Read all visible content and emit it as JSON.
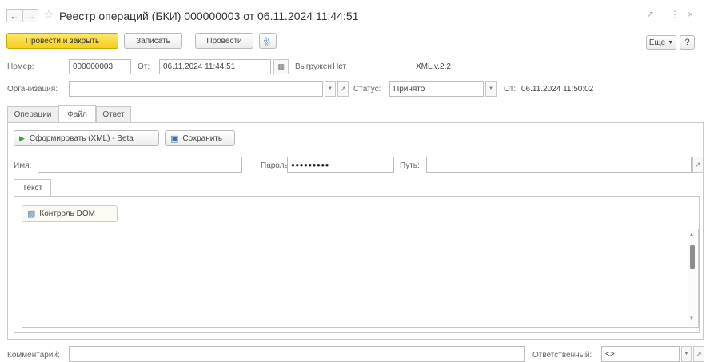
{
  "window": {
    "title": "Реестр операций (БКИ) 000000003 от 06.11.2024 11:44:51",
    "nav_back_icon": "arrow-left-icon",
    "nav_forward_icon": "arrow-right-icon",
    "favorite_icon": "star-icon",
    "link_icon": "link-icon",
    "menu_icon": "more-vertical-icon",
    "close_icon": "close-icon"
  },
  "toolbar": {
    "post_close_label": "Провести и закрыть",
    "save_label": "Записать",
    "post_label": "Провести",
    "more_label": "Еще",
    "help_label": "?"
  },
  "header": {
    "number_label": "Номер:",
    "number_value": "000000003",
    "date_label": "От:",
    "date_value": "06.11.2024 11:44:51",
    "exported_label": "Выгружен:",
    "exported_value": "Нет",
    "xml_version": "XML v.2.2",
    "org_label": "Организация:",
    "org_value": "",
    "status_label": "Статус:",
    "status_value": "Принято",
    "status_date_label": "От:",
    "status_date_value": "06.11.2024 11:50:02"
  },
  "tabs": [
    {
      "label": "Операции",
      "active": false
    },
    {
      "label": "Файл",
      "active": true
    },
    {
      "label": "Ответ",
      "active": false
    }
  ],
  "file_tab": {
    "generate_label": "Сформировать (XML) - Beta",
    "save_label": "Сохранить",
    "name_label": "Имя:",
    "name_value": "",
    "password_label": "Пароль:",
    "password_value": "●●●●●●●●●",
    "path_label": "Путь:",
    "path_value": "",
    "inner_tab_label": "Текст",
    "dom_check_label": "Контроль DOM",
    "text_content": ""
  },
  "footer": {
    "comment_label": "Комментарий:",
    "comment_value": "",
    "responsible_label": "Ответственный:",
    "responsible_value": "<>"
  },
  "colors": {
    "primary_button": "#f5cf1e",
    "border": "#bdbdbd",
    "play_green": "#3aa33a"
  }
}
